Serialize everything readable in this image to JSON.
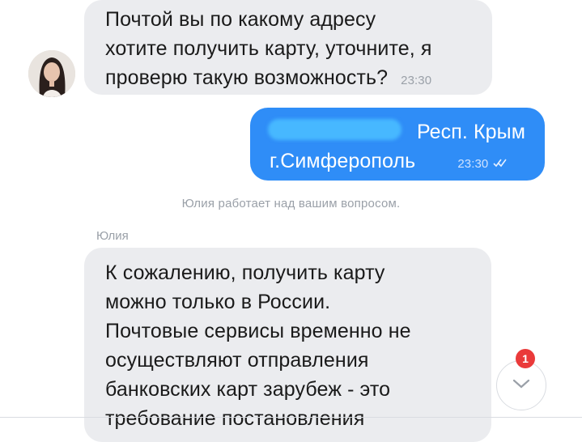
{
  "messages": [
    {
      "lines": [
        "Почтой вы по какому адресу",
        "хотите получить карту, уточните, я",
        "проверю такую возможность?"
      ],
      "time": "23:30"
    },
    {
      "lines": [
        "Респ. Крым",
        "г.Симферополь"
      ],
      "time": "23:30"
    },
    {
      "lines": [
        "К сожалению, получить карту",
        "можно только в России.",
        "Почтовые сервисы временно не",
        "осуществляют отправления",
        "банковских карт зарубеж - это",
        "требование постановления"
      ]
    }
  ],
  "status_text": "Юлия работает над вашим вопросом.",
  "sender_name": "Юлия",
  "unread_badge": "1",
  "icons": {
    "avatar": "agent-avatar",
    "read_receipt": "double-check-icon",
    "scroll_down": "chevron-down-icon"
  },
  "colors": {
    "outgoing_bubble": "#2f8df7",
    "incoming_bubble": "#ebecef",
    "badge": "#ea3a3a"
  }
}
